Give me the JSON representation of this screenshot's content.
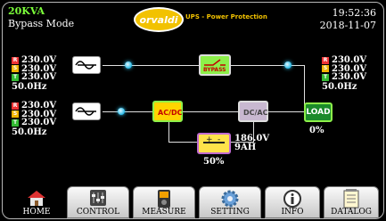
{
  "header": {
    "model": "20KVA",
    "mode": "Bypass Mode",
    "logo_text": "orvaldi",
    "logo_sub": "UPS - Power Protection",
    "time": "19:52:36",
    "date": "2018-11-07"
  },
  "bypass_input": {
    "tags": [
      "R",
      "S",
      "T"
    ],
    "voltages": [
      "230.0V",
      "230.0V",
      "230.0V"
    ],
    "frequency": "50.0Hz"
  },
  "main_input": {
    "tags": [
      "R",
      "S",
      "T"
    ],
    "voltages": [
      "230.0V",
      "230.0V",
      "230.0V"
    ],
    "frequency": "50.0Hz"
  },
  "output": {
    "tags": [
      "R",
      "S",
      "T"
    ],
    "voltages": [
      "230.0V",
      "230.0V",
      "230.0V"
    ],
    "frequency": "50.0Hz",
    "load_label": "LOAD",
    "load_percent": "0%"
  },
  "blocks": {
    "bypass_label": "BYPASS",
    "rectifier_label": "AC/DC",
    "inverter_label": "DC/AC"
  },
  "battery": {
    "voltage": "186.0V",
    "capacity": "9AH",
    "charge": "50%"
  },
  "tabs": [
    {
      "label": "HOME",
      "icon": "home-icon"
    },
    {
      "label": "CONTROL",
      "icon": "sliders-icon"
    },
    {
      "label": "MEASURE",
      "icon": "meter-icon"
    },
    {
      "label": "SETTING",
      "icon": "gear-icon"
    },
    {
      "label": "INFO",
      "icon": "info-icon"
    },
    {
      "label": "DATALOG",
      "icon": "notepad-icon"
    }
  ],
  "colors": {
    "accent_green": "#7cff3a",
    "logo_yellow": "#f2c200",
    "flow_dot": "#21b9e8"
  }
}
